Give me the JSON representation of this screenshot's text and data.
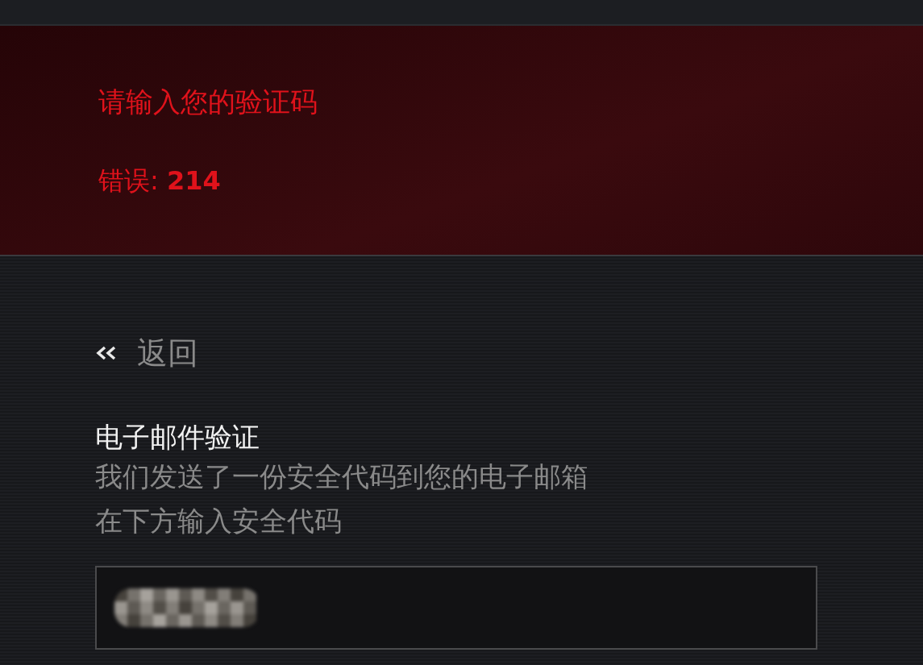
{
  "error_banner": {
    "title": "请输入您的验证码",
    "error": "错误: **214**"
  },
  "back_link": {
    "label": "返回"
  },
  "verification": {
    "title": "电子邮件验证",
    "lines": [
      "我们发送了一份安全代码到您的电子邮箱",
      "在下方输入安全代码"
    ]
  },
  "code_field": {
    "value_redacted": true
  }
}
